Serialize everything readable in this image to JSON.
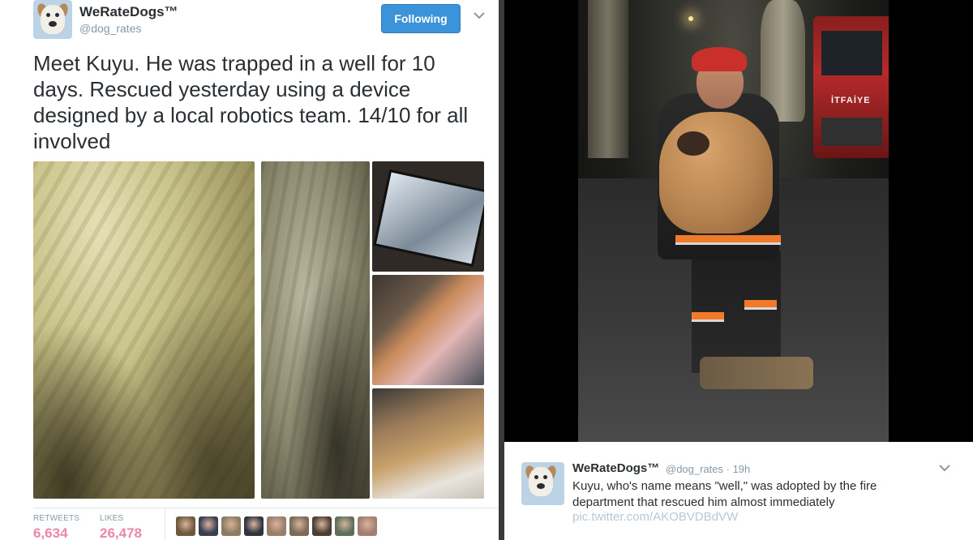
{
  "left_tweet": {
    "account_name": "WeRateDogs™",
    "handle": "@dog_rates",
    "follow_button": "Following",
    "text_lines": [
      "Meet Kuyu. He was trapped in a well for 10",
      "days. Rescued yesterday using a device",
      "designed by a local robotics team. 14/10 for all",
      "involved"
    ],
    "stats": {
      "retweets_label": "RETWEETS",
      "retweets_value": "6,634",
      "likes_label": "LIKES",
      "likes_value": "26,478"
    },
    "liker_avatar_colors": [
      "#6d5a3d",
      "#3a3e52",
      "#8c7b62",
      "#2f3440",
      "#9a7e6a",
      "#7a6a58",
      "#4a3f33",
      "#5d6f5b",
      "#a47e72"
    ]
  },
  "right_tweet": {
    "truck_sign": "İTFAİYE",
    "account_name": "WeRateDogs™",
    "handle_time": "@dog_rates · 19h",
    "text_lines": [
      "Kuyu, who's name means \"well,\" was adopted by the fire",
      "department that rescued him almost immediately"
    ],
    "link": "pic.twitter.com/AKOBVDBdVW"
  },
  "colors": {
    "follow_blue": "#3b94d9",
    "stat_red": "#e0245e",
    "muted": "#8899a6",
    "text": "#292f33"
  }
}
